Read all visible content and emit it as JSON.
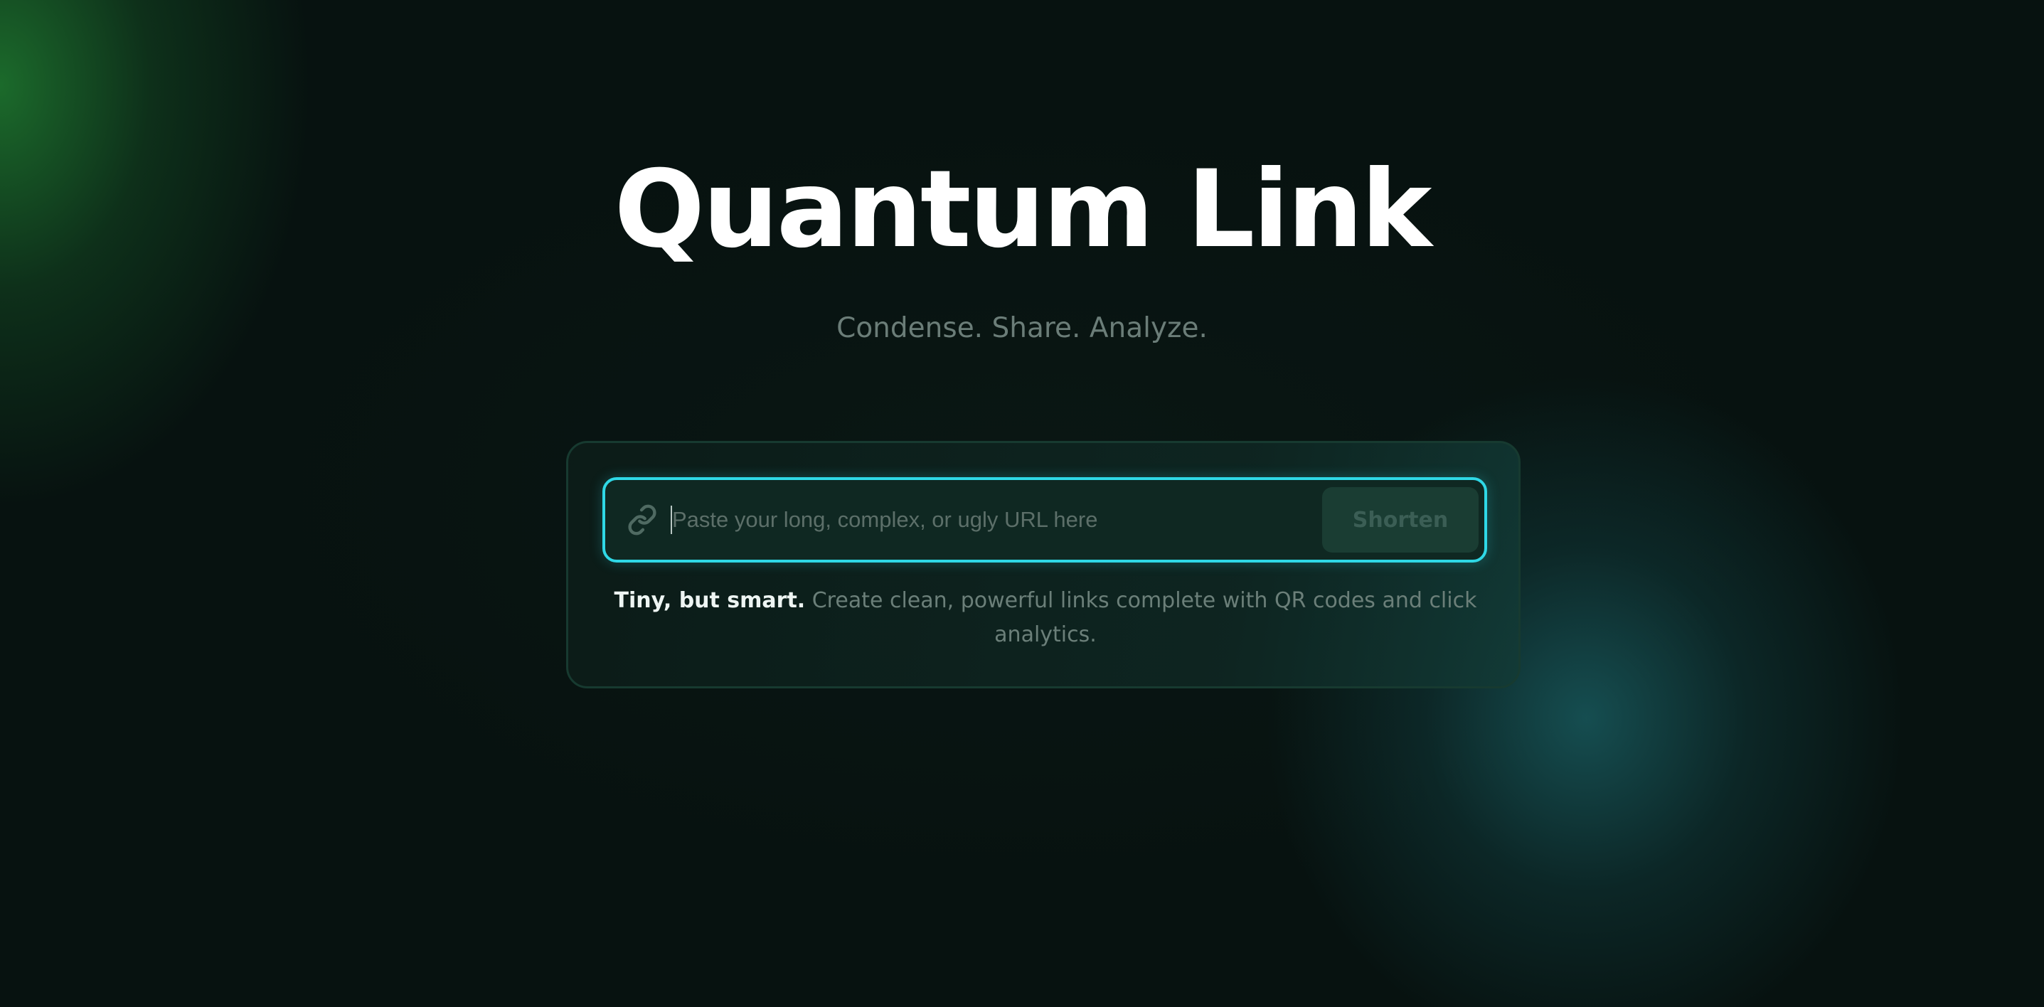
{
  "hero": {
    "title": "Quantum Link",
    "tagline": "Condense. Share. Analyze."
  },
  "shortener": {
    "input_value": "",
    "input_placeholder": "Paste your long, complex, or ugly URL here",
    "input_icon": "link-icon",
    "button_label": "Shorten",
    "note_strong": "Tiny, but smart.",
    "note_text": " Create clean, powerful links complete with QR codes and click analytics."
  },
  "colors": {
    "background": "#071210",
    "accent": "#2fd8e6",
    "glow_green": "#1f7a30",
    "glow_teal": "#18585c"
  }
}
